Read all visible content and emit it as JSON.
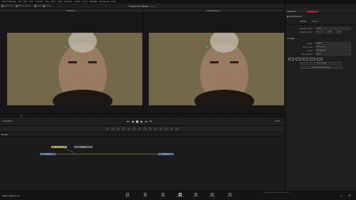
{
  "menu": [
    "DaVinci Resolve",
    "File",
    "Edit",
    "Trim",
    "Timeline",
    "Clip",
    "Mark",
    "View",
    "Playback",
    "Fusion",
    "Color",
    "Fairlight",
    "Workspace",
    "Help"
  ],
  "project": {
    "title": "Fusion for Editors",
    "subtitle": "Edited"
  },
  "toolbar": {
    "left": [
      "Media Pool",
      "Effects Library",
      "Clips",
      "Nodes"
    ],
    "right": [
      "Spline",
      "Keyframes",
      "Metadata",
      "Inspector"
    ]
  },
  "viewers": {
    "left_title": "MediaIn1",
    "right_title": "PlanarTracker1"
  },
  "transport": {
    "timecode": "01:00:00:00",
    "end_frame": "138.0"
  },
  "nodes": {
    "title": "Nodes",
    "items": [
      "MediaIn1",
      "PlanarTracker1",
      "Merge1",
      "MediaOut1"
    ]
  },
  "inspector": {
    "title": "Inspector",
    "node_name": "PlanarTracker1",
    "tabs": [
      "Controls",
      "Settings"
    ],
    "rows": [
      {
        "label": "Operation Mode",
        "value": "Track"
      },
      {
        "label": "Reference Time",
        "value": "0"
      },
      {
        "label": "Tracker",
        "value": "Hybrid"
      },
      {
        "label": "Motion Type",
        "value": "Perspective"
      },
      {
        "label": "Output",
        "value": "Background"
      },
      {
        "label": "Track Channel",
        "value": "Luma"
      }
    ],
    "buttons": [
      "Set",
      "Go",
      "Track to End",
      "Create Planar Transform"
    ]
  },
  "status": {
    "left": "DaVinci Resolve 17",
    "right": "Fusion Memory 6% | Frame 48 | 30 fps"
  },
  "pages": [
    "Media",
    "Cut",
    "Edit",
    "Fusion",
    "Color",
    "Fairlight",
    "Deliver"
  ],
  "active_page": "Fusion",
  "colors": {
    "track_point": "#41c24a",
    "selected_node": "#d2b24b",
    "link": "#caa740",
    "playhead": "#d53a3a"
  }
}
